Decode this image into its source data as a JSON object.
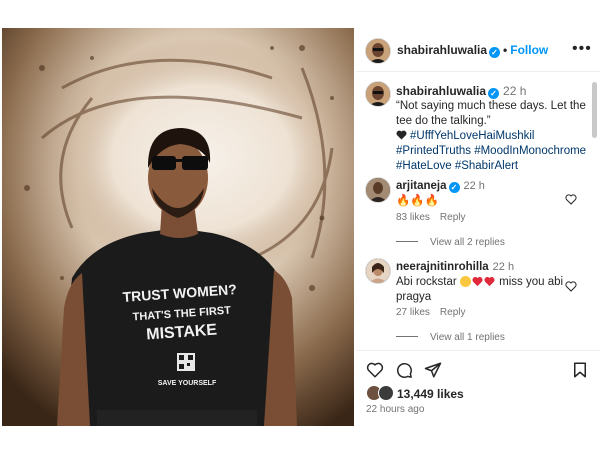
{
  "post": {
    "author": "shabirahluwalia",
    "follow_label": "Follow",
    "more_label": "•••",
    "caption_author": "shabirahluwalia",
    "caption_time": "22 h",
    "caption_text": "“Not saying much these days. Let the tee do the talking.”",
    "hashtags": [
      "#UfffYehLoveHaiMushkil",
      "#PrintedTruths",
      "#MoodInMonochrome",
      "#HateLove",
      "#ShabirAlert"
    ],
    "tshirt_lines": [
      "TRUST WOMEN?",
      "THAT'S THE FIRST",
      "MISTAKE",
      "SAVE YOURSELF"
    ]
  },
  "comments": [
    {
      "user": "arjitaneja",
      "verified": true,
      "time": "22 h",
      "text": "🔥🔥🔥",
      "likes": "83 likes",
      "reply_label": "Reply",
      "view_all": "View all 2 replies"
    },
    {
      "user": "neerajnitinrohilla",
      "verified": false,
      "time": "22 h",
      "text_before": "Abi rockstar",
      "text_after": "miss you abi pragya",
      "likes": "27 likes",
      "reply_label": "Reply",
      "view_all": "View all 1 replies"
    }
  ],
  "footer": {
    "likes": "13,449 likes",
    "posted": "22 hours ago"
  },
  "icons": {
    "like": "heart-icon",
    "comment": "comment-icon",
    "share": "send-icon",
    "save": "bookmark-icon",
    "verified": "verified-badge-icon"
  },
  "colors": {
    "accent": "#0095f6",
    "hashtag": "#00376b",
    "muted": "#737373",
    "like_red": "#ed4956"
  }
}
